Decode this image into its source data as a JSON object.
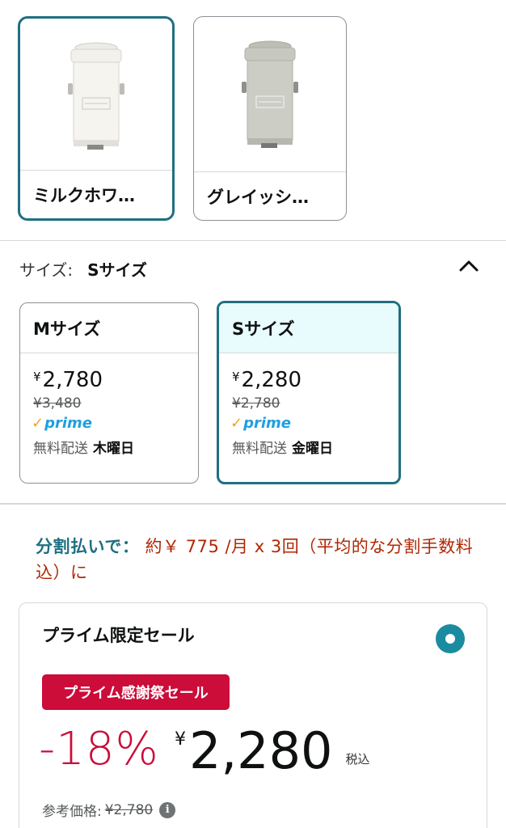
{
  "colors": {
    "selected_border": "#1f6f82",
    "selected_bg": "#e8fbfd",
    "deal_red": "#cc0c39",
    "installment_red": "#b12704",
    "radio": "#1b8ba0",
    "prime_blue": "#1f9fe0",
    "prime_check": "#f6a21d"
  },
  "color_options": [
    {
      "label": "ミルクホワ…",
      "swatch_color": "#f3f1eb",
      "icon": "trash-can-image",
      "selected": true
    },
    {
      "label": "グレイッシ…",
      "swatch_color": "#c7c9c0",
      "icon": "trash-can-image",
      "selected": false
    }
  ],
  "size": {
    "label": "サイズ:",
    "value": "Sサイズ",
    "collapse_icon": "chevron-up-icon"
  },
  "size_options": [
    {
      "name": "Mサイズ",
      "yen": "¥",
      "price": "2,780",
      "list_price": "¥3,480",
      "prime_check": "✓",
      "prime": "prime",
      "delivery_label": "無料配送",
      "delivery_day": "木曜日",
      "selected": false
    },
    {
      "name": "Sサイズ",
      "yen": "¥",
      "price": "2,280",
      "list_price": "¥2,780",
      "prime_check": "✓",
      "prime": "prime",
      "delivery_label": "無料配送",
      "delivery_day": "金曜日",
      "selected": true
    }
  ],
  "installment": {
    "lead": "分割払いで：",
    "text": " 約￥ 775 /月 x 3回（平均的な分割手数料込）に"
  },
  "offer": {
    "title": "プライム限定セール",
    "badge": "プライム感謝祭セール",
    "discount": "-18%",
    "yen": "¥",
    "price": "2,280",
    "tax_note": "税込",
    "ref_label": "参考価格:",
    "ref_price": "¥2,780",
    "info_icon": "i"
  }
}
